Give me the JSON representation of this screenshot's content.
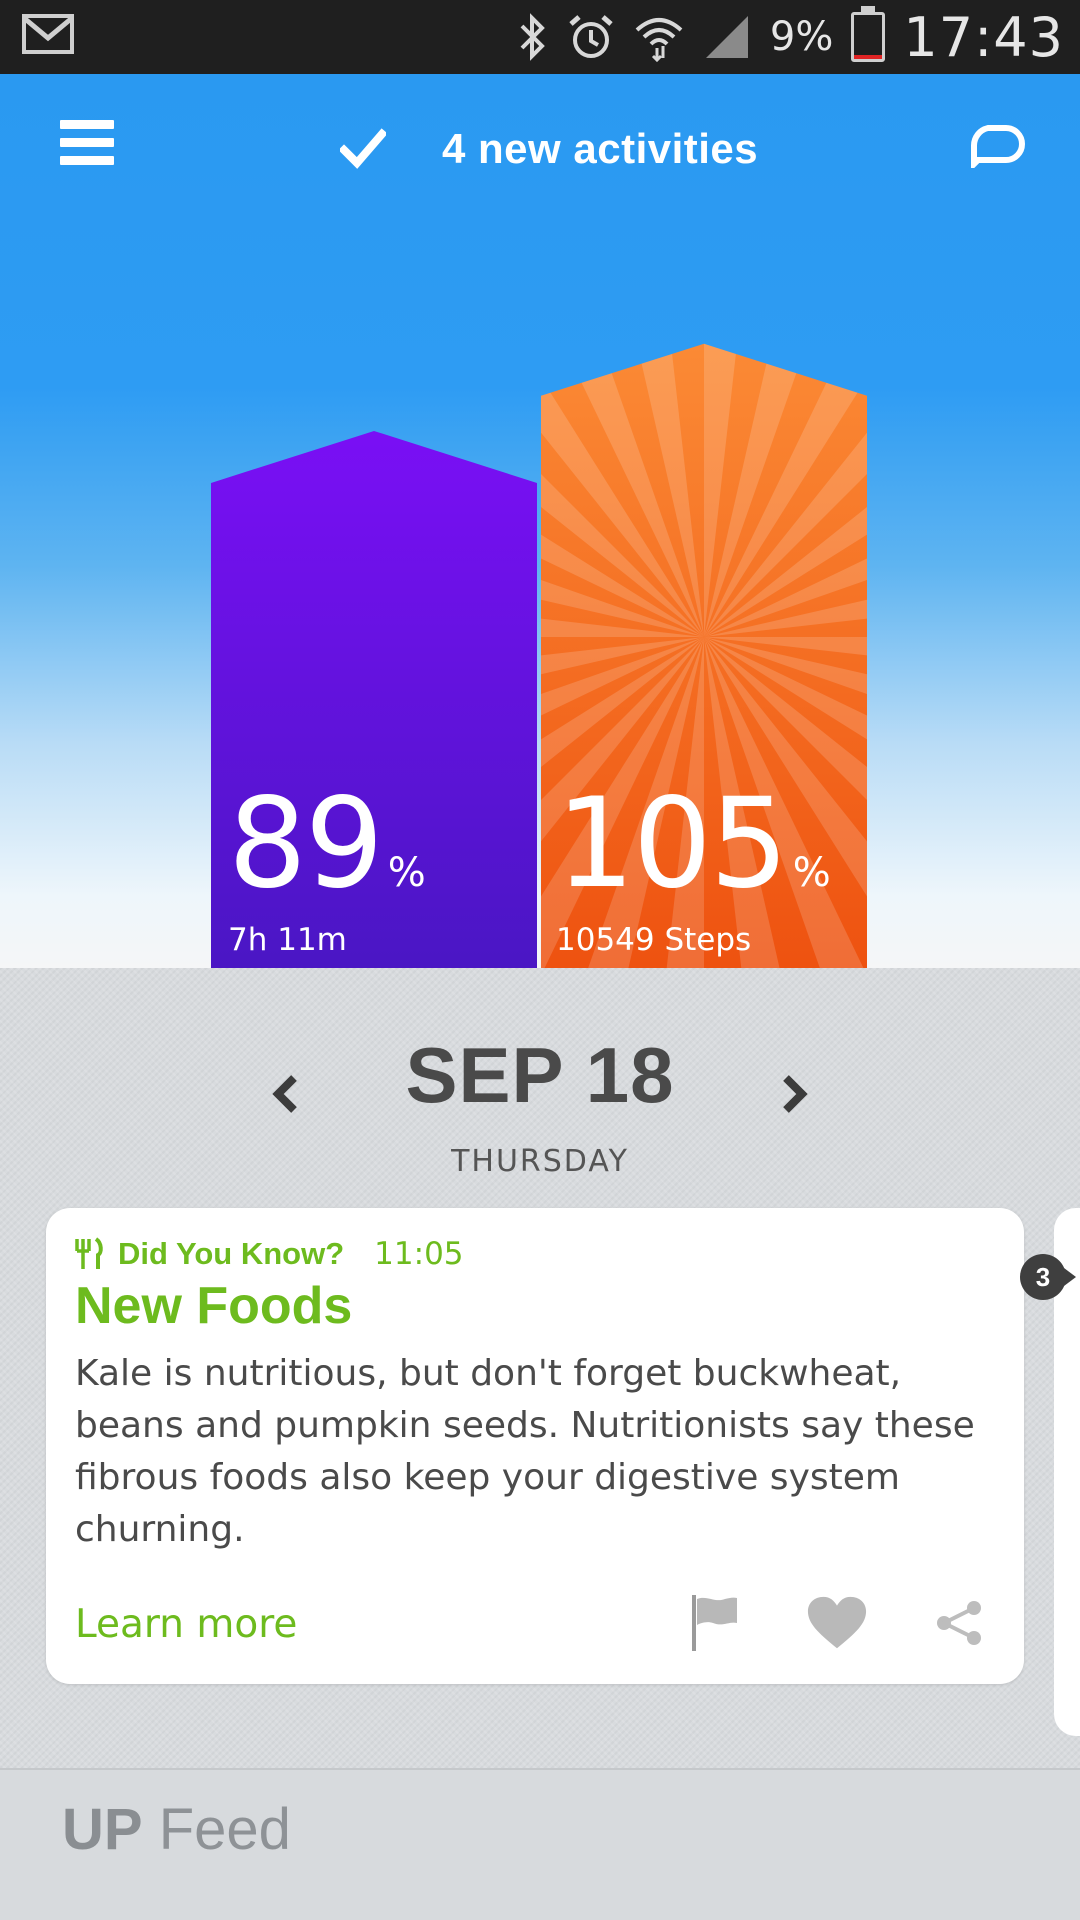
{
  "status_bar": {
    "icons": [
      "gmail-icon",
      "bluetooth-icon",
      "alarm-icon",
      "wifi-icon",
      "signal-icon"
    ],
    "battery": "9%",
    "battery_level": 0.09,
    "time": "17:43"
  },
  "header": {
    "activities_label": "4 new activities"
  },
  "bars": {
    "sleep": {
      "percent": "89",
      "unit": "%",
      "detail": "7h 11m",
      "value": 89,
      "color": "#5b16d6"
    },
    "steps": {
      "percent": "105",
      "unit": "%",
      "detail": "10549 Steps",
      "value": 105,
      "color": "#f15a1a"
    }
  },
  "date_nav": {
    "date": "SEP 18",
    "weekday": "THURSDAY"
  },
  "card": {
    "category": "Did You Know?",
    "time": "11:05",
    "title": "New Foods",
    "body": "Kale is nutritious, but don't forget buckwheat, beans and pumpkin seeds. Nutritionists say these fibrous foods also keep your digestive system churning.",
    "link": "Learn more",
    "accent": "#6dbb1e"
  },
  "badge_count": "3",
  "feed": {
    "title_bold": "UP",
    "title_rest": "Feed"
  }
}
